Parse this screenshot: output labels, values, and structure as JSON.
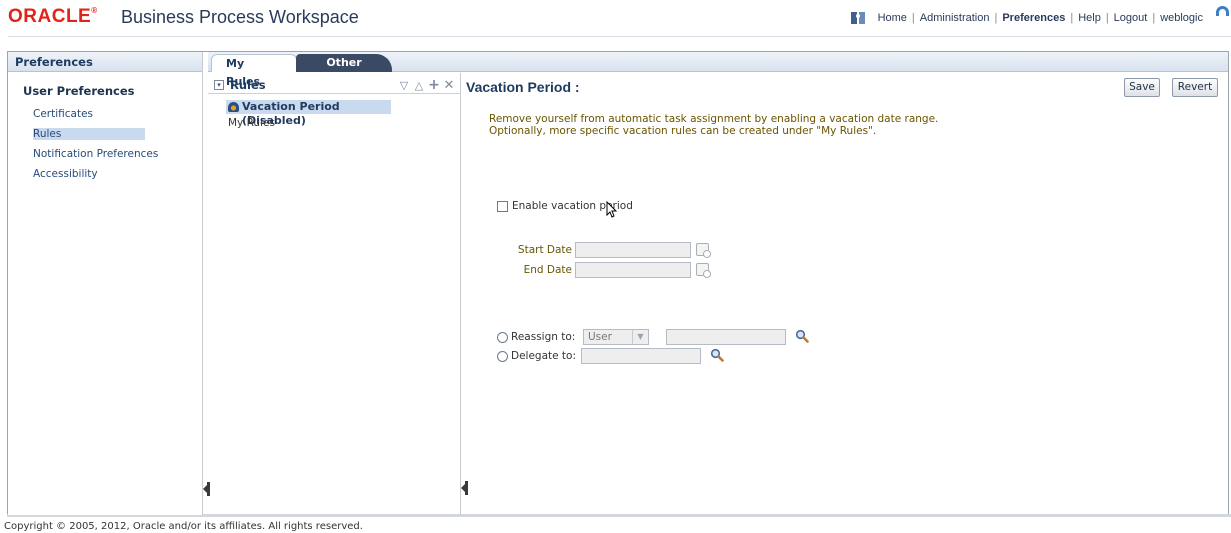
{
  "header": {
    "logo": "ORACLE",
    "app_title": "Business Process Workspace",
    "links": {
      "home": "Home",
      "administration": "Administration",
      "preferences": "Preferences",
      "help": "Help",
      "logout": "Logout",
      "user": "weblogic"
    }
  },
  "left_panel": {
    "header": "Preferences",
    "section_title": "User Preferences",
    "items": [
      {
        "label": "Certificates"
      },
      {
        "label": "Rules",
        "selected": true
      },
      {
        "label": "Notification Preferences"
      },
      {
        "label": "Accessibility"
      }
    ]
  },
  "tabs": [
    {
      "label": "My Rules",
      "active": true
    },
    {
      "label": "Other Rules",
      "active": false
    }
  ],
  "rules_panel": {
    "title": "Rules",
    "items": [
      {
        "label": "Vacation Period (Disabled)",
        "selected": true
      },
      {
        "label": "My Rules"
      }
    ]
  },
  "content": {
    "title": "Vacation Period :",
    "save_label": "Save",
    "revert_label": "Revert",
    "info_line1": "Remove yourself from automatic task assignment by enabling a vacation date range.",
    "info_line2": "Optionally, more specific vacation rules can be created under \"My Rules\".",
    "enable_label": "Enable vacation period",
    "enable_checked": false,
    "start_date_label": "Start Date",
    "start_date_value": "",
    "end_date_label": "End Date",
    "end_date_value": "",
    "reassign_label": "Reassign to:",
    "reassign_type": "User",
    "reassign_value": "",
    "delegate_label": "Delegate to:",
    "delegate_value": ""
  },
  "footer": {
    "copyright": "Copyright © 2005, 2012, Oracle and/or its affiliates. All rights reserved."
  },
  "colors": {
    "brand_red": "#e2231a",
    "title_navy": "#1f3a5f",
    "selection": "#c9d9ee",
    "info_text": "#6a5500"
  }
}
